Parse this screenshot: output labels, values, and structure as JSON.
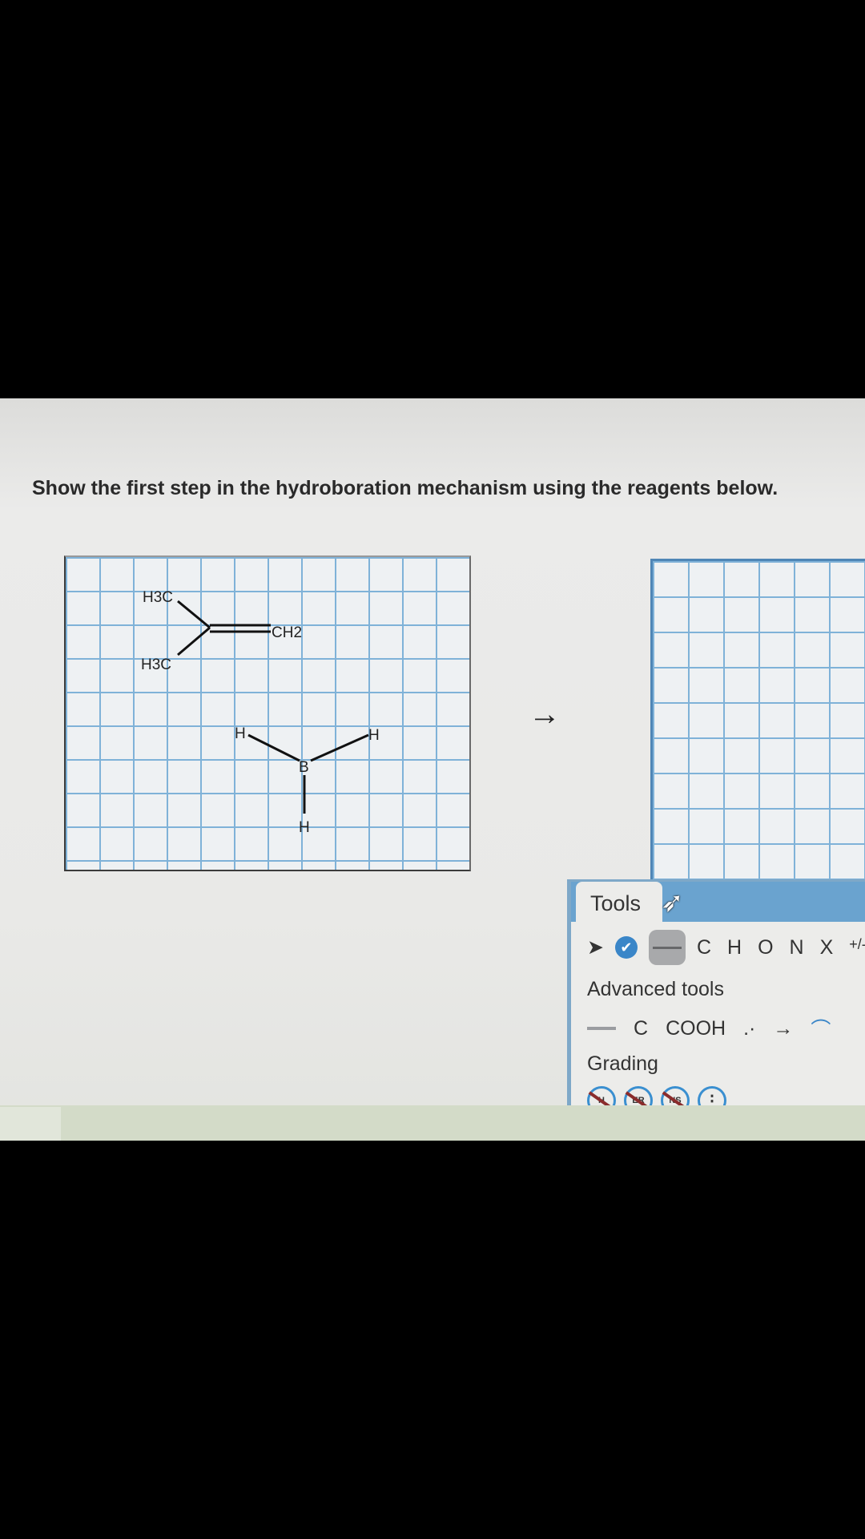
{
  "question": "Show the first step in the hydroboration mechanism using the reagents below.",
  "reagents": {
    "alkene": {
      "methyl_top": "H3C",
      "methyl_bottom": "H3C",
      "methylene": "CH2"
    },
    "borane": {
      "boron": "B",
      "h_left": "H",
      "h_right": "H",
      "h_bottom": "H"
    }
  },
  "reaction_arrow": "→",
  "tools": {
    "title": "Tools",
    "basic": [
      "C",
      "H",
      "O",
      "N",
      "X"
    ],
    "charge_label": "+/-",
    "advanced_label": "Advanced tools",
    "advanced": {
      "carbon": "C",
      "carboxyl": "COOH",
      "electrons": ".·",
      "arrow": "→",
      "curved_arrow": "⌒"
    },
    "grading_label": "Grading",
    "grading_buttons": [
      "H",
      "ER",
      "NS"
    ],
    "more": "⋮"
  },
  "colors": {
    "grid": "#7fb2d8",
    "accent": "#6aa3cf",
    "check": "#3a86c8"
  }
}
